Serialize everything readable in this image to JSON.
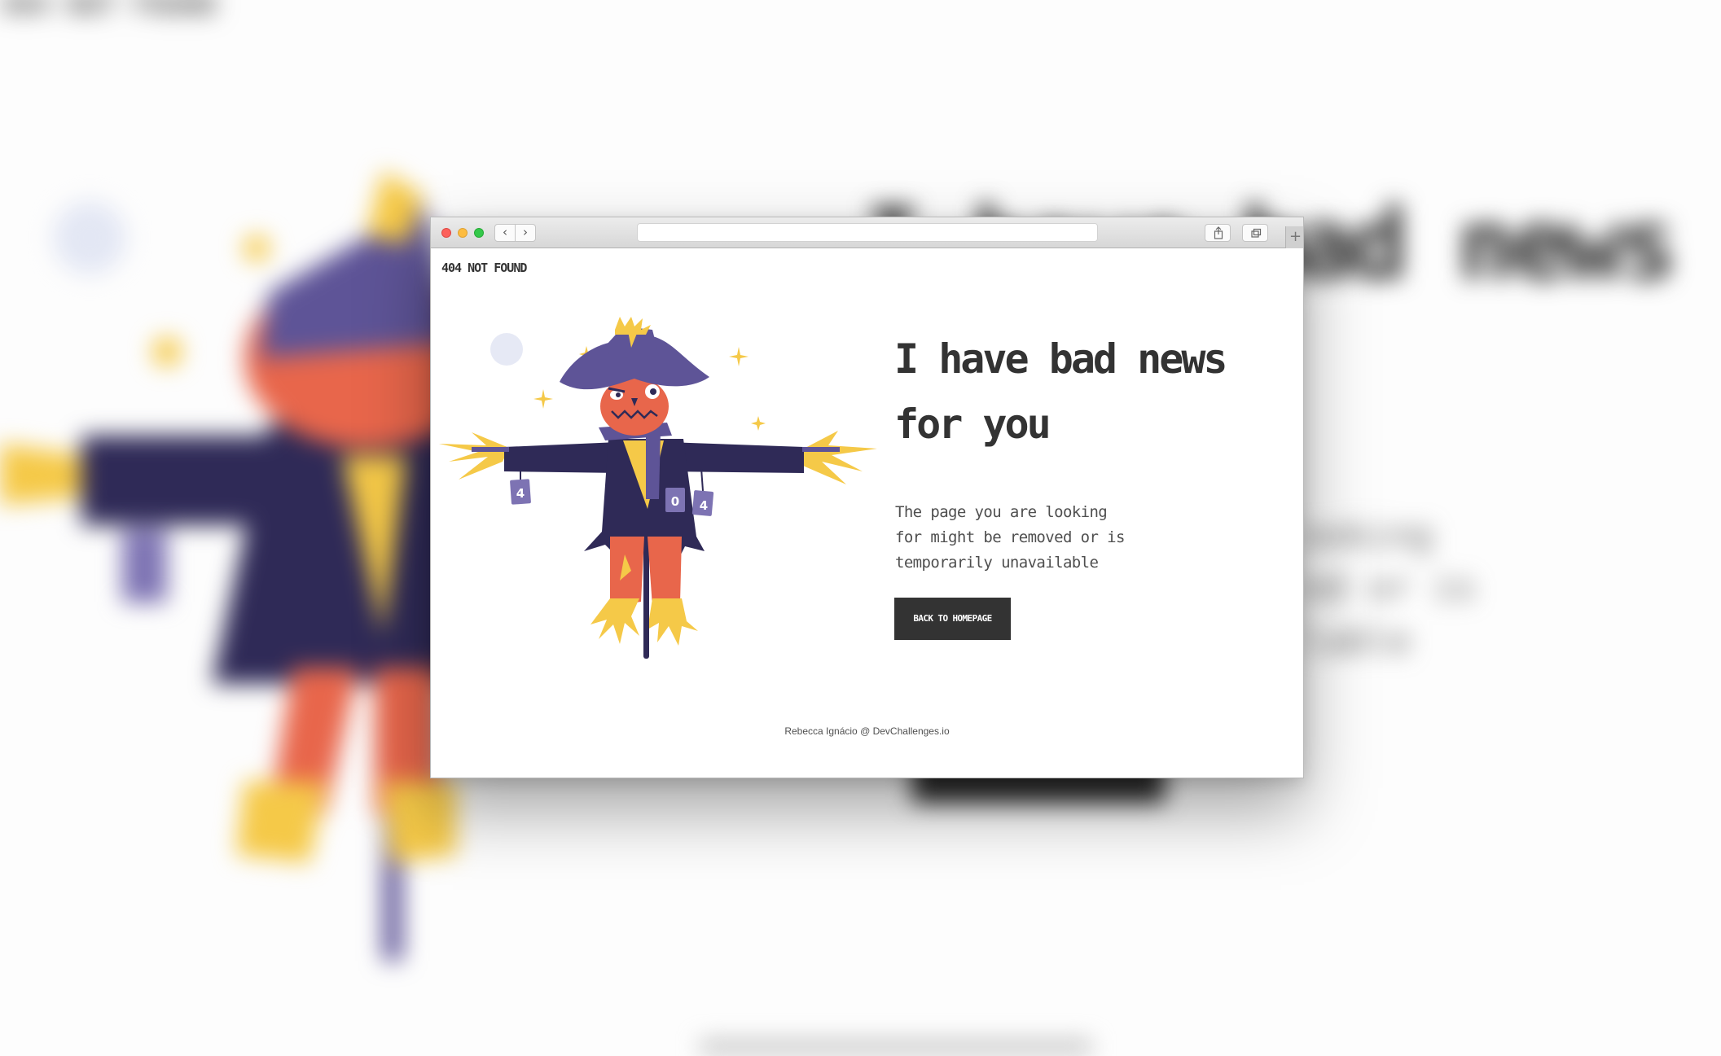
{
  "page": {
    "brand": "404 NOT FOUND",
    "headline_line1": "I have bad news",
    "headline_line2": "for you",
    "description_line1": "The page you are looking",
    "description_line2": "for might be removed or is",
    "description_line3": "temporarily unavailable",
    "cta_label": "BACK TO HOMEPAGE",
    "footer": "Rebecca Ignácio @ DevChallenges.io"
  },
  "backdrop": {
    "headline": "I have bad news",
    "description_fragment_1": "ooking",
    "description_fragment_2": "ed or is",
    "description_fragment_3": "lable"
  },
  "illustration": {
    "can_labels": [
      "4",
      "0",
      "4"
    ]
  },
  "window": {
    "address_value": ""
  },
  "icons": [
    "close-icon",
    "minimize-icon",
    "maximize-icon",
    "chevron-left-icon",
    "chevron-right-icon",
    "share-icon",
    "tabs-icon",
    "plus-icon"
  ],
  "colors": {
    "text_dark": "#333333",
    "text_body": "#4f4f4f",
    "button_bg": "#333333",
    "hat_purple": "#5e5497",
    "coat_navy": "#2f2a57",
    "face_orange": "#e8664b",
    "straw_yellow": "#f5c948",
    "moon": "#e6e9f5"
  }
}
